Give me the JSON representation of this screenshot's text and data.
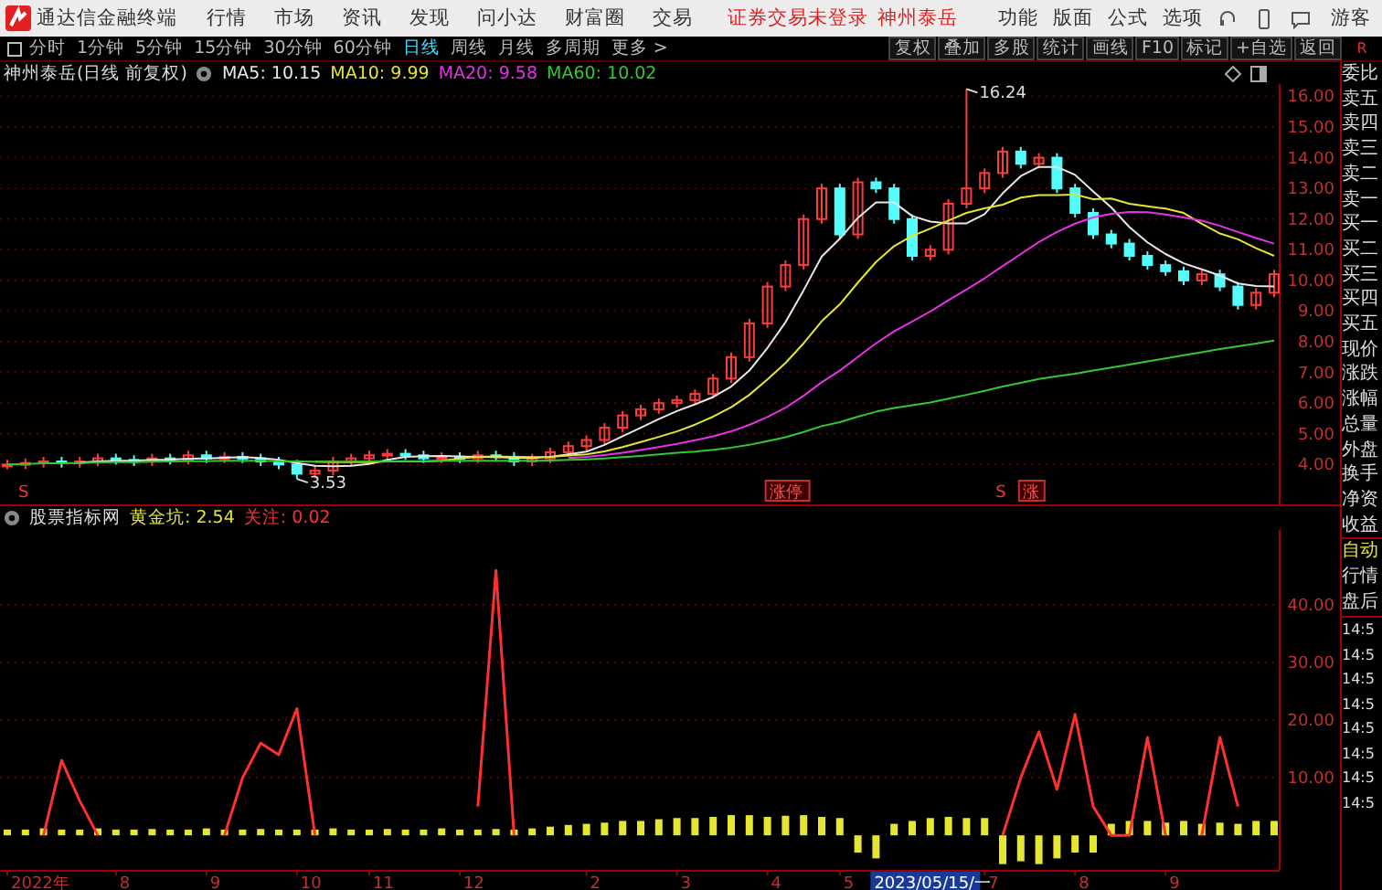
{
  "title_bar": {
    "app_name": "通达信金融终端",
    "menu": [
      "行情",
      "市场",
      "资讯",
      "发现",
      "问小达",
      "财富圈",
      "交易"
    ],
    "login_status": "证券交易未登录",
    "stock_link": "神州泰岳",
    "tools": [
      "功能",
      "版面",
      "公式",
      "选项"
    ],
    "user": "游客"
  },
  "period_tabs": [
    {
      "label": "分时",
      "selected": false
    },
    {
      "label": "1分钟",
      "selected": false
    },
    {
      "label": "5分钟",
      "selected": false
    },
    {
      "label": "15分钟",
      "selected": false
    },
    {
      "label": "30分钟",
      "selected": false
    },
    {
      "label": "60分钟",
      "selected": false
    },
    {
      "label": "日线",
      "selected": true
    },
    {
      "label": "周线",
      "selected": false
    },
    {
      "label": "月线",
      "selected": false
    },
    {
      "label": "多周期",
      "selected": false
    },
    {
      "label": "更多 >",
      "selected": false
    }
  ],
  "tool_buttons": [
    "复权",
    "叠加",
    "多股",
    "统计",
    "画线",
    "F10",
    "标记",
    "+自选",
    "返回"
  ],
  "corner_label": "R",
  "legend": {
    "title": "神州泰岳(日线 前复权)",
    "separator": ": ",
    "readings": [
      "10.15",
      "9.99",
      "9.58",
      "10.02"
    ]
  },
  "main_chart": {
    "high_label": "16.24",
    "low_label": "3.53",
    "chart_data": {
      "type": "candlestick",
      "grid": true,
      "ylim": [
        2.7,
        16.4
      ],
      "yticks": [
        {
          "value": 4,
          "label": "4.00"
        },
        {
          "value": 5,
          "label": "5.00"
        },
        {
          "value": 6,
          "label": "6.00"
        },
        {
          "value": 7,
          "label": "7.00"
        },
        {
          "value": 8,
          "label": "8.00"
        },
        {
          "value": 9,
          "label": "9.00"
        },
        {
          "value": 10,
          "label": "10.00"
        },
        {
          "value": 11,
          "label": "11.00"
        },
        {
          "value": 12,
          "label": "12.00"
        },
        {
          "value": 13,
          "label": "13.00"
        },
        {
          "value": 14,
          "label": "14.00"
        },
        {
          "value": 15,
          "label": "15.00"
        },
        {
          "value": 16,
          "label": "16.00"
        }
      ],
      "ohlc": [
        [
          4.0,
          4.15,
          3.85,
          4.0
        ],
        [
          4.0,
          4.2,
          3.85,
          4.05
        ],
        [
          4.05,
          4.25,
          3.9,
          4.1
        ],
        [
          4.1,
          4.25,
          3.9,
          4.05
        ],
        [
          4.05,
          4.25,
          3.9,
          4.1
        ],
        [
          4.1,
          4.35,
          3.95,
          4.2
        ],
        [
          4.2,
          4.35,
          4.0,
          4.15
        ],
        [
          4.15,
          4.3,
          3.95,
          4.1
        ],
        [
          4.1,
          4.35,
          3.95,
          4.2
        ],
        [
          4.2,
          4.35,
          4.0,
          4.15
        ],
        [
          4.15,
          4.45,
          4.0,
          4.3
        ],
        [
          4.3,
          4.45,
          4.05,
          4.2
        ],
        [
          4.2,
          4.4,
          4.05,
          4.25
        ],
        [
          4.25,
          4.4,
          4.05,
          4.2
        ],
        [
          4.2,
          4.35,
          3.95,
          4.1
        ],
        [
          4.1,
          4.25,
          3.85,
          4.0
        ],
        [
          4.0,
          4.15,
          3.53,
          3.7
        ],
        [
          3.7,
          3.95,
          3.55,
          3.8
        ],
        [
          3.8,
          4.25,
          3.65,
          4.1
        ],
        [
          4.1,
          4.35,
          3.95,
          4.2
        ],
        [
          4.2,
          4.45,
          4.05,
          4.3
        ],
        [
          4.3,
          4.5,
          4.15,
          4.35
        ],
        [
          4.35,
          4.5,
          4.15,
          4.3
        ],
        [
          4.3,
          4.45,
          4.05,
          4.2
        ],
        [
          4.2,
          4.4,
          4.05,
          4.25
        ],
        [
          4.25,
          4.4,
          4.05,
          4.2
        ],
        [
          4.2,
          4.45,
          4.05,
          4.3
        ],
        [
          4.3,
          4.45,
          4.1,
          4.25
        ],
        [
          4.25,
          4.4,
          3.95,
          4.1
        ],
        [
          4.1,
          4.35,
          3.95,
          4.2
        ],
        [
          4.2,
          4.55,
          4.05,
          4.4
        ],
        [
          4.4,
          4.75,
          4.25,
          4.6
        ],
        [
          4.6,
          4.95,
          4.45,
          4.8
        ],
        [
          4.8,
          5.35,
          4.65,
          5.2
        ],
        [
          5.2,
          5.75,
          5.05,
          5.6
        ],
        [
          5.6,
          5.95,
          5.45,
          5.8
        ],
        [
          5.8,
          6.15,
          5.65,
          6.0
        ],
        [
          6.0,
          6.25,
          5.85,
          6.1
        ],
        [
          6.1,
          6.45,
          5.95,
          6.3
        ],
        [
          6.3,
          6.95,
          6.15,
          6.8
        ],
        [
          6.8,
          7.65,
          6.65,
          7.5
        ],
        [
          7.5,
          8.75,
          7.35,
          8.6
        ],
        [
          8.6,
          9.95,
          8.45,
          9.8
        ],
        [
          9.8,
          10.65,
          9.65,
          10.5
        ],
        [
          10.5,
          12.15,
          10.35,
          12.0
        ],
        [
          12.0,
          13.15,
          11.85,
          13.0
        ],
        [
          13.0,
          13.15,
          11.35,
          11.5
        ],
        [
          11.5,
          13.35,
          11.35,
          13.2
        ],
        [
          13.2,
          13.35,
          12.85,
          13.0
        ],
        [
          13.0,
          13.15,
          11.85,
          12.0
        ],
        [
          12.0,
          12.15,
          10.65,
          10.8
        ],
        [
          10.8,
          11.15,
          10.65,
          11.0
        ],
        [
          11.0,
          12.65,
          10.85,
          12.5
        ],
        [
          12.5,
          16.24,
          12.35,
          13.0
        ],
        [
          13.0,
          13.65,
          12.85,
          13.5
        ],
        [
          13.5,
          14.35,
          13.35,
          14.2
        ],
        [
          14.2,
          14.35,
          13.65,
          13.8
        ],
        [
          13.8,
          14.15,
          13.65,
          14.0
        ],
        [
          14.0,
          14.15,
          12.85,
          13.0
        ],
        [
          13.0,
          13.15,
          12.05,
          12.2
        ],
        [
          12.2,
          12.35,
          11.35,
          11.5
        ],
        [
          11.5,
          11.65,
          11.05,
          11.2
        ],
        [
          11.2,
          11.35,
          10.65,
          10.8
        ],
        [
          10.8,
          10.95,
          10.35,
          10.5
        ],
        [
          10.5,
          10.65,
          10.15,
          10.3
        ],
        [
          10.3,
          10.45,
          9.85,
          10.0
        ],
        [
          10.0,
          10.35,
          9.85,
          10.2
        ],
        [
          10.2,
          10.35,
          9.65,
          9.8
        ],
        [
          9.8,
          9.95,
          9.05,
          9.2
        ],
        [
          9.2,
          9.75,
          9.05,
          9.6
        ],
        [
          9.6,
          10.35,
          9.45,
          10.2
        ]
      ],
      "series": [
        {
          "name": "MA5",
          "color": "#e8e8e8",
          "type": "line",
          "values": [
            null,
            null,
            null,
            null,
            4.06,
            4.1,
            4.12,
            4.12,
            4.15,
            4.16,
            4.19,
            4.2,
            4.22,
            4.24,
            4.21,
            4.15,
            4.05,
            3.96,
            3.94,
            3.96,
            4.02,
            4.15,
            4.25,
            4.27,
            4.28,
            4.26,
            4.25,
            4.24,
            4.22,
            4.21,
            4.25,
            4.33,
            4.42,
            4.64,
            4.92,
            5.2,
            5.48,
            5.74,
            5.96,
            6.2,
            6.54,
            7.06,
            7.8,
            8.64,
            9.68,
            10.78,
            11.36,
            12.04,
            12.54,
            12.54,
            12.1,
            11.92,
            11.86,
            11.86,
            12.16,
            12.84,
            13.4,
            13.7,
            13.7,
            13.44,
            12.9,
            12.38,
            11.74,
            11.24,
            10.86,
            10.56,
            10.36,
            10.16,
            9.9,
            9.82,
            9.8
          ]
        },
        {
          "name": "MA10",
          "color": "#e6e632",
          "type": "line",
          "values": [
            null,
            null,
            null,
            null,
            null,
            null,
            null,
            null,
            null,
            null,
            null,
            null,
            null,
            null,
            null,
            null,
            null,
            4.09,
            4.08,
            4.08,
            4.08,
            4.1,
            4.1,
            4.1,
            4.12,
            4.2,
            4.25,
            4.26,
            4.25,
            4.24,
            4.25,
            4.29,
            4.33,
            4.43,
            4.57,
            4.73,
            4.9,
            5.08,
            5.3,
            5.56,
            5.87,
            6.27,
            6.77,
            7.31,
            7.95,
            8.67,
            9.22,
            9.93,
            10.6,
            11.12,
            11.45,
            11.69,
            11.95,
            12.2,
            12.35,
            12.47,
            12.7,
            12.78,
            12.78,
            12.8,
            12.65,
            12.67,
            12.5,
            12.42,
            12.34,
            12.2,
            11.85,
            11.53,
            11.34,
            11.05,
            10.8
          ]
        },
        {
          "name": "MA20",
          "color": "#e632e6",
          "type": "line",
          "values": [
            null,
            null,
            null,
            null,
            null,
            null,
            null,
            null,
            null,
            null,
            null,
            null,
            null,
            null,
            null,
            null,
            null,
            null,
            null,
            null,
            null,
            null,
            null,
            null,
            null,
            null,
            null,
            null,
            null,
            null,
            null,
            4.21,
            4.25,
            4.31,
            4.38,
            4.47,
            4.57,
            4.67,
            4.79,
            4.92,
            5.08,
            5.29,
            5.55,
            5.85,
            6.24,
            6.68,
            7.06,
            7.51,
            7.95,
            8.34,
            8.66,
            8.99,
            9.35,
            9.7,
            10.07,
            10.47,
            10.86,
            11.25,
            11.58,
            11.85,
            12.05,
            12.17,
            12.23,
            12.22,
            12.15,
            12.05,
            11.95,
            11.78,
            11.58,
            11.38,
            11.2
          ]
        },
        {
          "name": "MA60",
          "color": "#32c832",
          "type": "line",
          "values": [
            4.0,
            4.02,
            4.04,
            4.04,
            4.05,
            4.07,
            4.08,
            4.08,
            4.09,
            4.1,
            4.11,
            4.11,
            4.12,
            4.12,
            4.12,
            4.11,
            4.1,
            4.09,
            4.09,
            4.09,
            4.1,
            4.11,
            4.11,
            4.11,
            4.12,
            4.12,
            4.12,
            4.12,
            4.12,
            4.12,
            4.13,
            4.15,
            4.17,
            4.2,
            4.24,
            4.28,
            4.33,
            4.38,
            4.42,
            4.48,
            4.55,
            4.64,
            4.76,
            4.89,
            5.06,
            5.25,
            5.38,
            5.56,
            5.72,
            5.84,
            5.93,
            6.02,
            6.15,
            6.27,
            6.4,
            6.54,
            6.66,
            6.79,
            6.88,
            6.96,
            7.06,
            7.16,
            7.26,
            7.36,
            7.46,
            7.56,
            7.66,
            7.76,
            7.85,
            7.94,
            8.04
          ]
        }
      ]
    },
    "markers": [
      {
        "text": "S",
        "boxed": false
      },
      {
        "text": "涨停",
        "boxed": true
      },
      {
        "text": "S",
        "boxed": false
      },
      {
        "text": "涨",
        "boxed": true
      }
    ]
  },
  "indicator": {
    "name": "股票指标网",
    "readings": [
      "2.54",
      "0.02"
    ],
    "chart_data": {
      "type": "line",
      "grid": true,
      "ylim": [
        -6,
        53
      ],
      "yticks": [
        {
          "value": 10,
          "label": "10.00"
        },
        {
          "value": 20,
          "label": "20.00"
        },
        {
          "value": 30,
          "label": "30.00"
        },
        {
          "value": 40,
          "label": "40.00"
        }
      ],
      "series": [
        {
          "name": "黄金坑",
          "color": "#e6e632",
          "type": "bar",
          "values": [
            1,
            1,
            1.2,
            1,
            1,
            1.2,
            1,
            1,
            1.1,
            1,
            1,
            1.2,
            1,
            1,
            1.1,
            1,
            1,
            1,
            1.2,
            1,
            1,
            1.1,
            1,
            1,
            1.2,
            1,
            1,
            1.1,
            1,
            1.2,
            1.5,
            1.8,
            2,
            2.2,
            2.5,
            2.5,
            2.8,
            3,
            3,
            3.2,
            3.5,
            3.5,
            3.2,
            3.4,
            3.5,
            3.2,
            3,
            -3,
            -4,
            2,
            2.5,
            3,
            3.2,
            3,
            3,
            -5,
            -4.5,
            -5,
            -4,
            -3,
            -3,
            2,
            2.5,
            2.5,
            2.2,
            2.5,
            2,
            2.2,
            2,
            2.5,
            2.5
          ]
        },
        {
          "name": "关注",
          "color": "#ff3030",
          "type": "line",
          "values": [
            null,
            null,
            0,
            13,
            6,
            0,
            null,
            null,
            null,
            null,
            null,
            null,
            0,
            10,
            16,
            14,
            22,
            0,
            null,
            null,
            null,
            null,
            null,
            null,
            null,
            null,
            5,
            46,
            0,
            null,
            null,
            null,
            null,
            null,
            null,
            null,
            null,
            null,
            null,
            null,
            null,
            null,
            null,
            null,
            null,
            null,
            null,
            null,
            null,
            null,
            null,
            null,
            null,
            null,
            null,
            0,
            10,
            18,
            8,
            21,
            5,
            0,
            0,
            17,
            0,
            null,
            0,
            17,
            5,
            null,
            null
          ]
        }
      ]
    },
    "x_axis_labels": [
      "2022年",
      "8",
      "9",
      "10",
      "11",
      "12",
      "2",
      "3",
      "4",
      "5",
      "7",
      "8",
      "9"
    ],
    "cursor_date": "2023/05/15/一"
  },
  "side_panel": {
    "quote_labels": [
      "委比",
      "卖五",
      "卖四",
      "卖三",
      "卖二",
      "卖一",
      "买一",
      "买二",
      "买三",
      "买四",
      "买五",
      "现价",
      "涨跌",
      "涨幅",
      "总量",
      "外盘",
      "换手",
      "净资",
      "收益"
    ],
    "mode": "自动",
    "links": [
      "行情",
      "盘后"
    ],
    "times": [
      "14:5",
      "14:5",
      "14:5",
      "14:5",
      "14:5",
      "14:5",
      "14:5",
      "14:5"
    ]
  }
}
